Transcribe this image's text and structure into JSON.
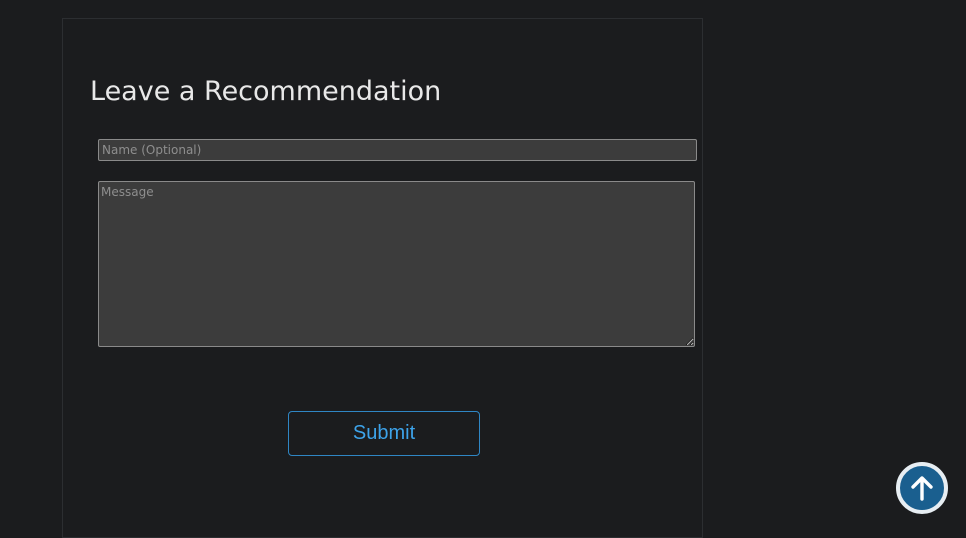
{
  "form": {
    "title": "Leave a Recommendation",
    "name_placeholder": "Name (Optional)",
    "name_value": "",
    "message_placeholder": "Message",
    "message_value": "",
    "submit_label": "Submit"
  },
  "scroll_top": {
    "icon": "arrow-up-icon"
  },
  "colors": {
    "background": "#1b1c1e",
    "accent": "#3da3ea",
    "scroll_button": "#1a5f8f"
  }
}
